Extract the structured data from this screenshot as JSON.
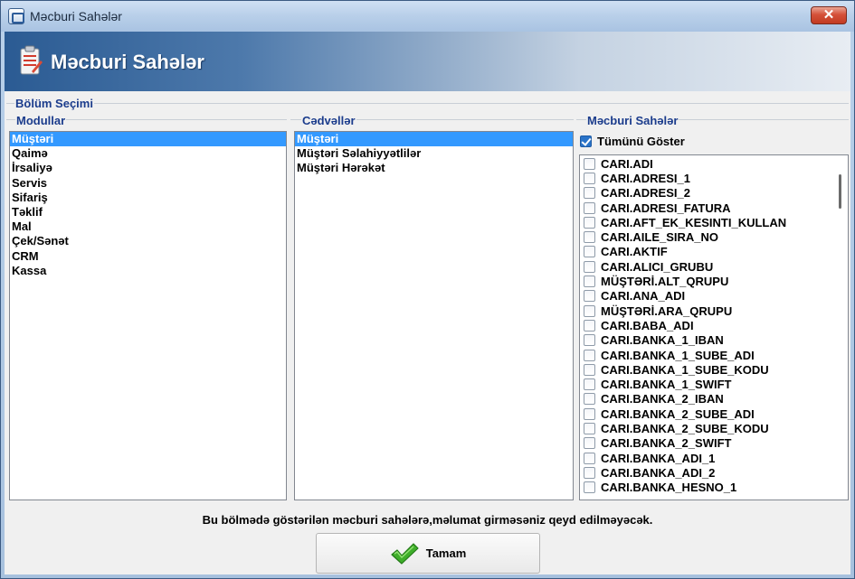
{
  "window": {
    "title": "Məcburi Sahələr",
    "close_glyph": "✕"
  },
  "banner": {
    "title": "Məcburi Sahələr",
    "icon": "clipboard-icon"
  },
  "sections": {
    "selection": "Bölüm Seçimi",
    "modules": "Modullar",
    "tables": "Cədvəllər",
    "required_fields": "Məcburi Sahələr"
  },
  "modules": [
    "Müştəri",
    "Qaimə",
    "İrsaliyə",
    "Servis",
    "Sifariş",
    "Təklif",
    "Mal",
    "Çek/Sənət",
    "CRM",
    "Kassa"
  ],
  "modules_selected_index": 0,
  "tables": [
    "Müştəri",
    "Müştəri Səlahiyyətlilər",
    "Müştəri Hərəkət"
  ],
  "tables_selected_index": 0,
  "show_all": {
    "label": "Tümünü Göster",
    "checked": true
  },
  "fields": [
    "CARI.ADI",
    "CARI.ADRESI_1",
    "CARI.ADRESI_2",
    "CARI.ADRESI_FATURA",
    "CARI.AFT_EK_KESINTI_KULLAN",
    "CARI.AILE_SIRA_NO",
    "CARI.AKTIF",
    "CARI.ALICI_GRUBU",
    "MÜŞTƏRİ.ALT_QRUPU",
    "CARI.ANA_ADI",
    "MÜŞTƏRİ.ARA_QRUPU",
    "CARI.BABA_ADI",
    "CARI.BANKA_1_IBAN",
    "CARI.BANKA_1_SUBE_ADI",
    "CARI.BANKA_1_SUBE_KODU",
    "CARI.BANKA_1_SWIFT",
    "CARI.BANKA_2_IBAN",
    "CARI.BANKA_2_SUBE_ADI",
    "CARI.BANKA_2_SUBE_KODU",
    "CARI.BANKA_2_SWIFT",
    "CARI.BANKA_ADI_1",
    "CARI.BANKA_ADI_2",
    "CARI.BANKA_HESNO_1"
  ],
  "footer": {
    "message": "Bu bölmədə göstərilən məcburi sahələrə,məlumat girməsəniz qeyd edilməyəcək."
  },
  "ok_button": {
    "label": "Tamam",
    "icon": "checkmark-icon"
  }
}
